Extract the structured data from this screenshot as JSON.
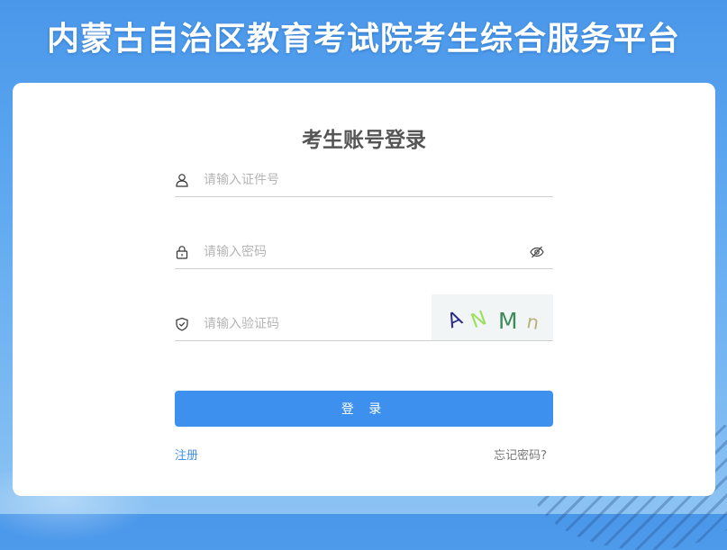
{
  "header": {
    "title": "内蒙古自治区教育考试院考生综合服务平台"
  },
  "login": {
    "title": "考生账号登录",
    "id_placeholder": "请输入证件号",
    "password_placeholder": "请输入密码",
    "captcha_placeholder": "请输入验证码",
    "captcha_chars": [
      "A",
      "N",
      "M",
      "n"
    ],
    "captcha_colors": [
      "#2a2a8a",
      "#9be05a",
      "#3f8a5a",
      "#b8b27a"
    ],
    "login_button": "登 录",
    "register_link": "注册",
    "forgot_link": "忘记密码?"
  },
  "icons": {
    "id": "user-icon",
    "password": "lock-icon",
    "eye": "eye-hidden-icon",
    "captcha": "shield-check-icon"
  },
  "colors": {
    "primary": "#3e90ef",
    "background": "#4a97ea"
  }
}
